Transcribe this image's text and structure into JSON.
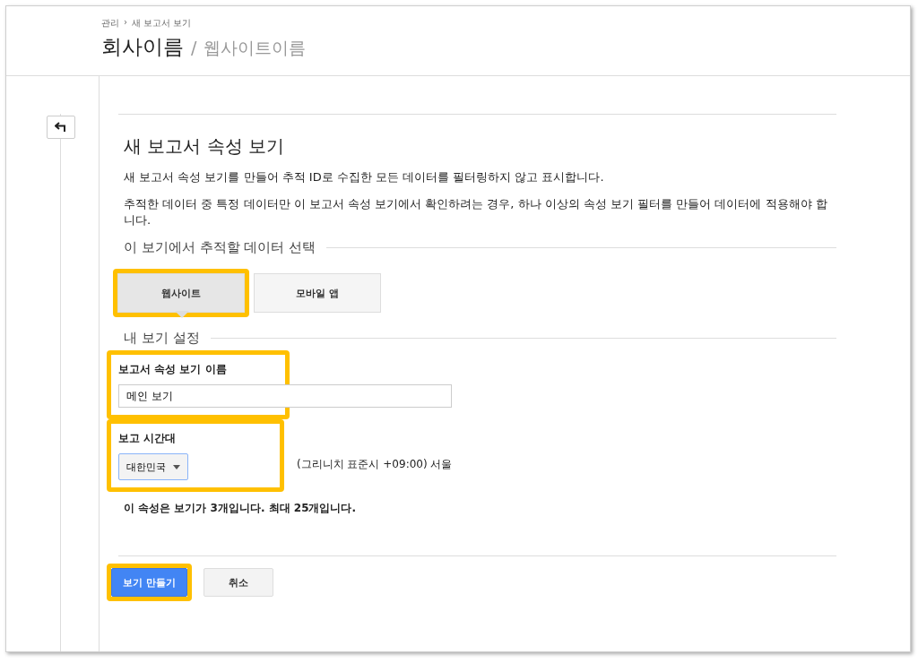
{
  "breadcrumb": [
    "관리",
    "›",
    "새 보고서 보기"
  ],
  "header": {
    "account": "회사이름",
    "separator": "/",
    "property": "웹사이트이름"
  },
  "section": {
    "title": "새 보고서 속성 보기",
    "paragraphs": [
      "새 보고서 속성 보기를 만들어 추적 ID로 수집한 모든 데이터를 필터링하지 않고 표시합니다.",
      "추적한 데이터 중 특정 데이터만 이 보고서 속성 보기에서 확인하려는 경우, 하나 이상의 속성 보기 필터를 만들어 데이터에 적용해야 합니다."
    ]
  },
  "data_choice": {
    "heading": "이 보기에서 추적할 데이터 선택",
    "options": [
      {
        "label": "웹사이트",
        "selected": true,
        "highlighted": true
      },
      {
        "label": "모바일 앱",
        "selected": false,
        "highlighted": false
      }
    ]
  },
  "settings": {
    "heading": "내 보기 설정",
    "name_field": {
      "label": "보고서 속성 보기 이름",
      "value": "메인 보기",
      "highlighted": true
    },
    "timezone": {
      "label": "보고 시간대",
      "country": "대한민국",
      "zone": "(그리니치 표준시 +09:00) 서울",
      "highlighted": true
    },
    "note": "이 속성은 보기가 3개입니다. 최대 25개입니다."
  },
  "buttons": [
    {
      "label": "보기 만들기",
      "kind": "primary",
      "highlighted": true
    },
    {
      "label": "취소",
      "kind": "secondary",
      "highlighted": false
    }
  ]
}
